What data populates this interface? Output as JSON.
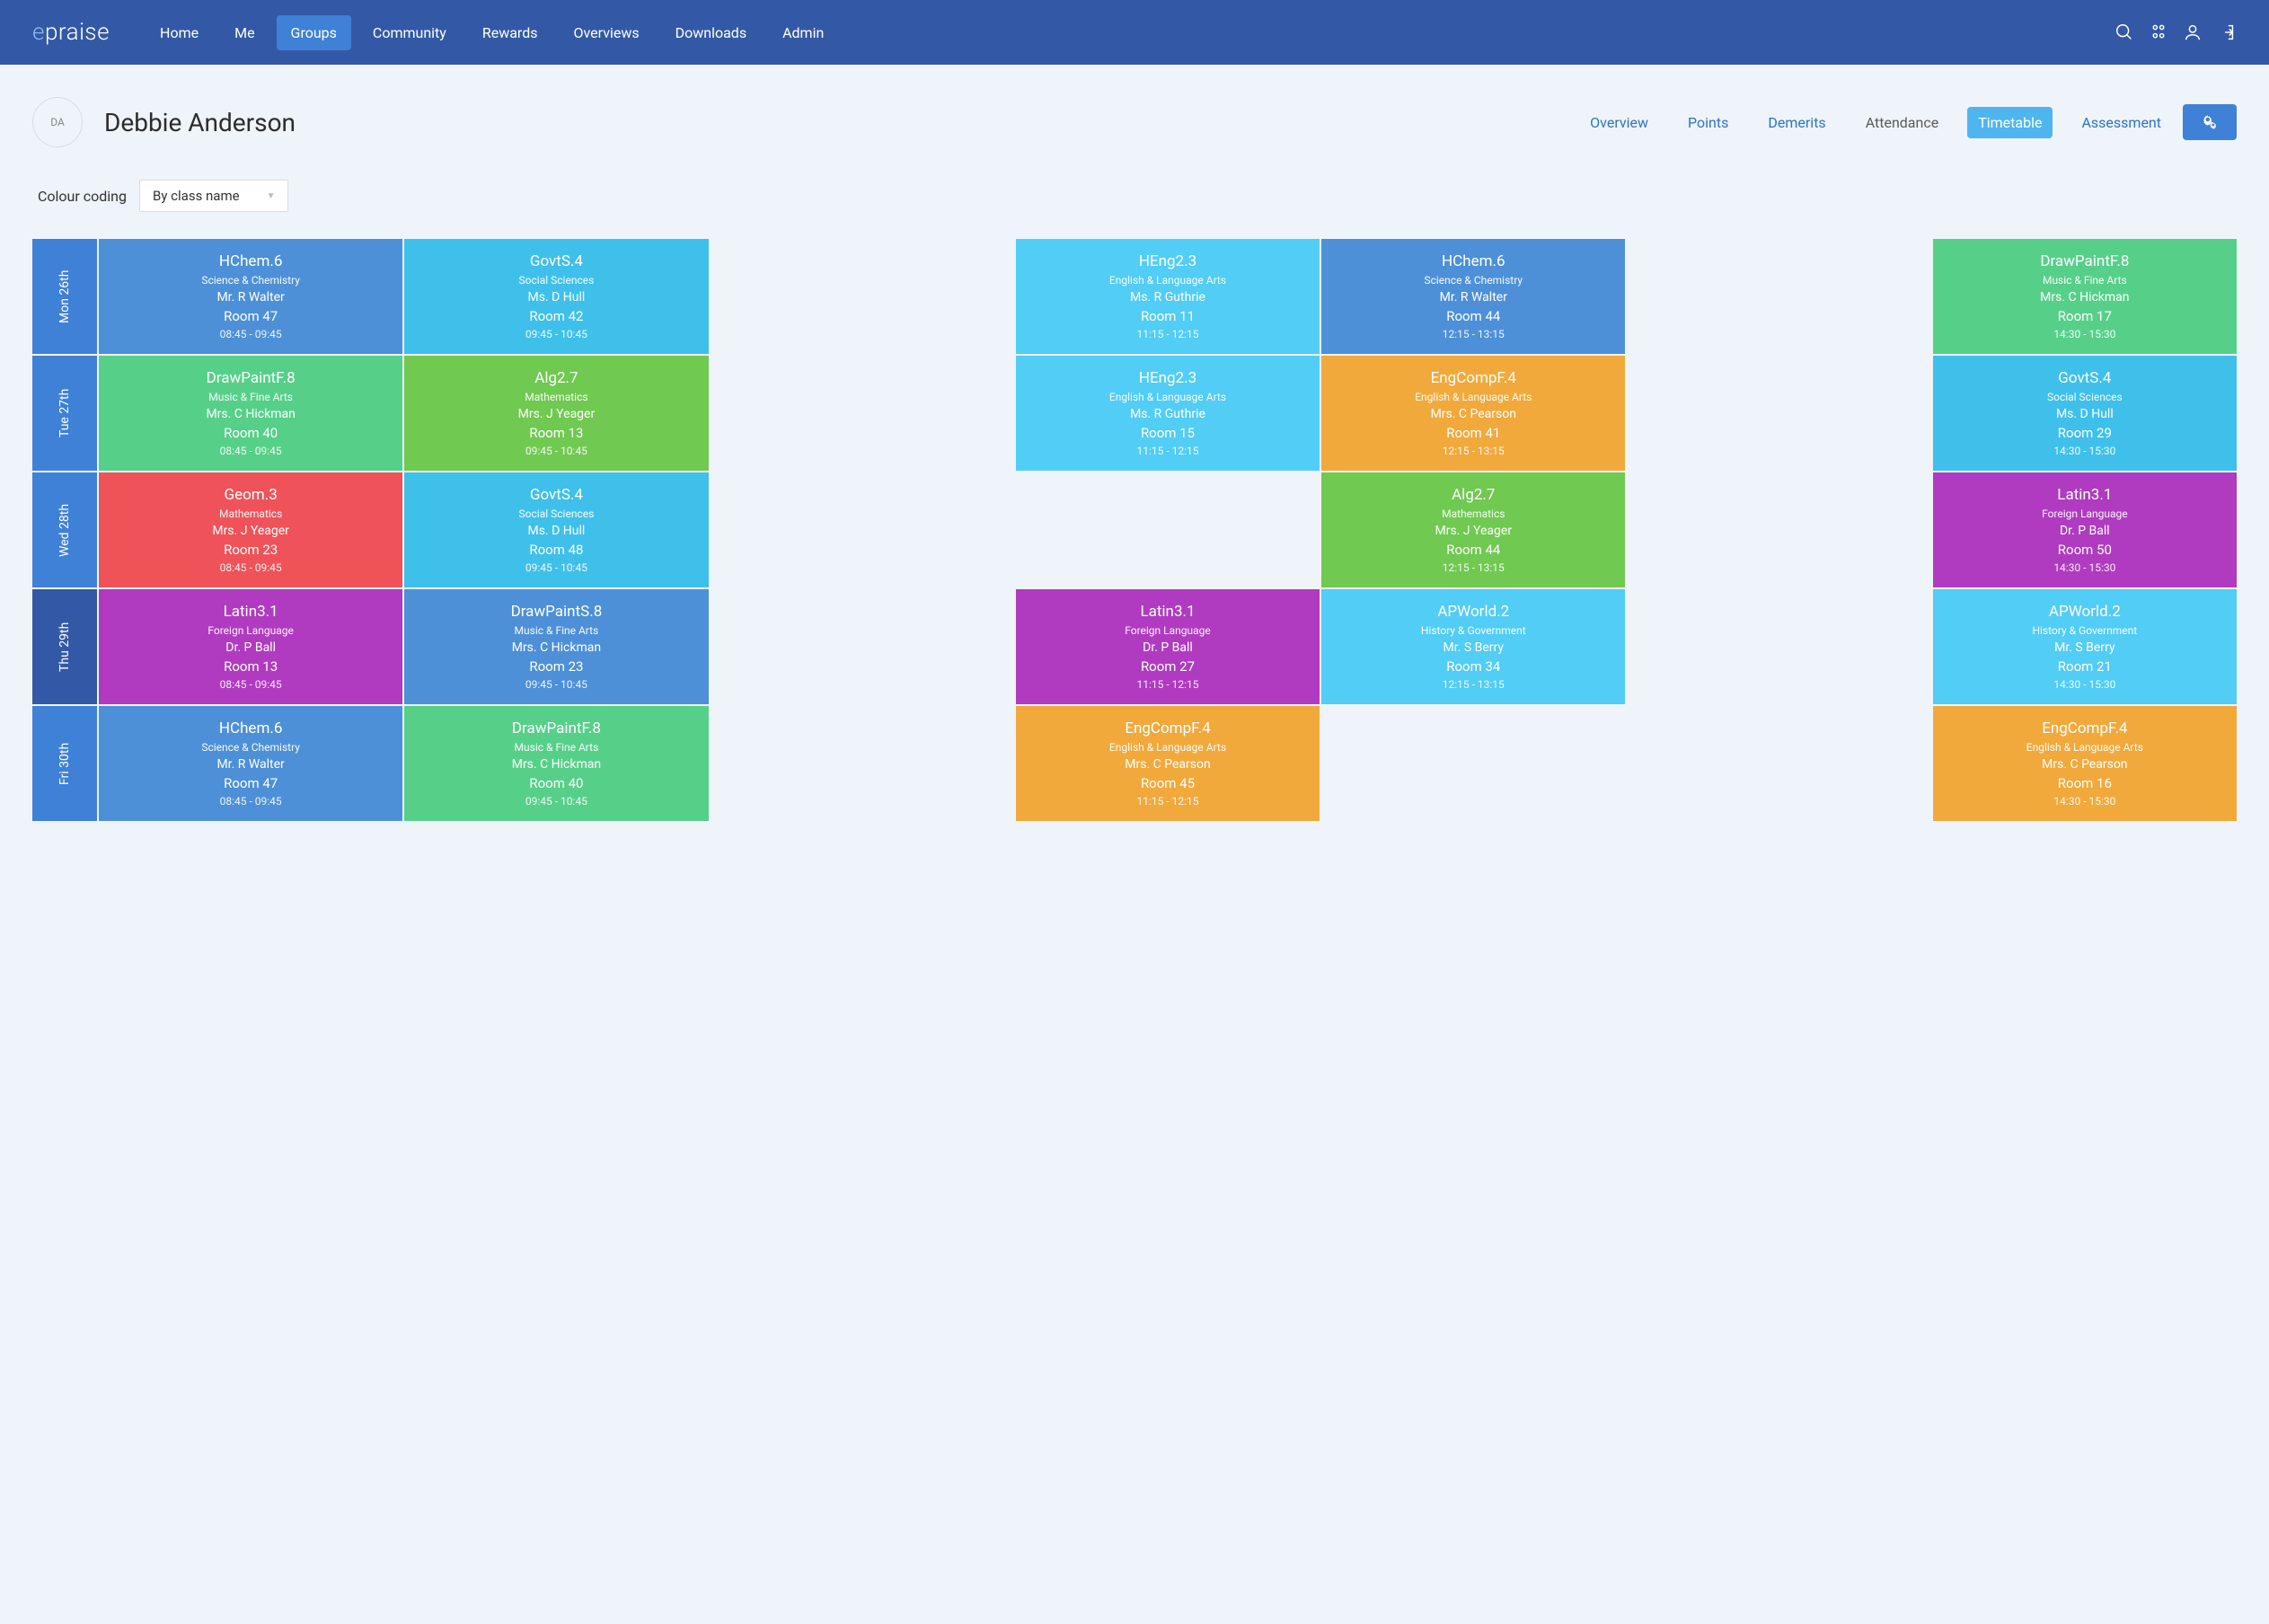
{
  "logo": {
    "e": "e",
    "rest": "praise"
  },
  "nav": [
    "Home",
    "Me",
    "Groups",
    "Community",
    "Rewards",
    "Overviews",
    "Downloads",
    "Admin"
  ],
  "nav_active": 2,
  "avatar_initials": "DA",
  "student_name": "Debbie Anderson",
  "tabs": [
    "Overview",
    "Points",
    "Demerits",
    "Attendance",
    "Timetable",
    "Assessment"
  ],
  "tab_active": 4,
  "tab_muted": [
    3
  ],
  "colour_coding_label": "Colour coding",
  "dropdown_value": "By class name",
  "colors": {
    "blue": "#4d90d8",
    "lightblue": "#3fc0eb",
    "skyblue": "#52cdf5",
    "green": "#56d089",
    "green2": "#70c951",
    "orange": "#f2a93c",
    "red": "#ef5359",
    "purple": "#b03bc0"
  },
  "days": [
    {
      "label": "Mon 26th",
      "darker": false,
      "cells": [
        {
          "code": "HChem.6",
          "dept": "Science & Chemistry",
          "teacher": "Mr. R Walter",
          "room": "Room 47",
          "time": "08:45 - 09:45",
          "color": "blue"
        },
        {
          "code": "GovtS.4",
          "dept": "Social Sciences",
          "teacher": "Ms. D Hull",
          "room": "Room 42",
          "time": "09:45 - 10:45",
          "color": "lightblue"
        },
        null,
        {
          "code": "HEng2.3",
          "dept": "English & Language Arts",
          "teacher": "Ms. R Guthrie",
          "room": "Room 11",
          "time": "11:15 - 12:15",
          "color": "skyblue"
        },
        {
          "code": "HChem.6",
          "dept": "Science & Chemistry",
          "teacher": "Mr. R Walter",
          "room": "Room 44",
          "time": "12:15 - 13:15",
          "color": "blue"
        },
        null,
        {
          "code": "DrawPaintF.8",
          "dept": "Music & Fine Arts",
          "teacher": "Mrs. C Hickman",
          "room": "Room 17",
          "time": "14:30 - 15:30",
          "color": "green"
        }
      ]
    },
    {
      "label": "Tue 27th",
      "darker": false,
      "cells": [
        {
          "code": "DrawPaintF.8",
          "dept": "Music & Fine Arts",
          "teacher": "Mrs. C Hickman",
          "room": "Room 40",
          "time": "08:45 - 09:45",
          "color": "green"
        },
        {
          "code": "Alg2.7",
          "dept": "Mathematics",
          "teacher": "Mrs. J Yeager",
          "room": "Room 13",
          "time": "09:45 - 10:45",
          "color": "green2"
        },
        null,
        {
          "code": "HEng2.3",
          "dept": "English & Language Arts",
          "teacher": "Ms. R Guthrie",
          "room": "Room 15",
          "time": "11:15 - 12:15",
          "color": "skyblue"
        },
        {
          "code": "EngCompF.4",
          "dept": "English & Language Arts",
          "teacher": "Mrs. C Pearson",
          "room": "Room 41",
          "time": "12:15 - 13:15",
          "color": "orange"
        },
        null,
        {
          "code": "GovtS.4",
          "dept": "Social Sciences",
          "teacher": "Ms. D Hull",
          "room": "Room 29",
          "time": "14:30 - 15:30",
          "color": "lightblue"
        }
      ]
    },
    {
      "label": "Wed 28th",
      "darker": false,
      "cells": [
        {
          "code": "Geom.3",
          "dept": "Mathematics",
          "teacher": "Mrs. J Yeager",
          "room": "Room 23",
          "time": "08:45 - 09:45",
          "color": "red"
        },
        {
          "code": "GovtS.4",
          "dept": "Social Sciences",
          "teacher": "Ms. D Hull",
          "room": "Room 48",
          "time": "09:45 - 10:45",
          "color": "lightblue"
        },
        null,
        null,
        {
          "code": "Alg2.7",
          "dept": "Mathematics",
          "teacher": "Mrs. J Yeager",
          "room": "Room 44",
          "time": "12:15 - 13:15",
          "color": "green2"
        },
        null,
        {
          "code": "Latin3.1",
          "dept": "Foreign Language",
          "teacher": "Dr. P Ball",
          "room": "Room 50",
          "time": "14:30 - 15:30",
          "color": "purple"
        }
      ]
    },
    {
      "label": "Thu 29th",
      "darker": true,
      "cells": [
        {
          "code": "Latin3.1",
          "dept": "Foreign Language",
          "teacher": "Dr. P Ball",
          "room": "Room 13",
          "time": "08:45 - 09:45",
          "color": "purple"
        },
        {
          "code": "DrawPaintS.8",
          "dept": "Music & Fine Arts",
          "teacher": "Mrs. C Hickman",
          "room": "Room 23",
          "time": "09:45 - 10:45",
          "color": "blue"
        },
        null,
        {
          "code": "Latin3.1",
          "dept": "Foreign Language",
          "teacher": "Dr. P Ball",
          "room": "Room 27",
          "time": "11:15 - 12:15",
          "color": "purple"
        },
        {
          "code": "APWorld.2",
          "dept": "History & Government",
          "teacher": "Mr. S Berry",
          "room": "Room 34",
          "time": "12:15 - 13:15",
          "color": "skyblue"
        },
        null,
        {
          "code": "APWorld.2",
          "dept": "History & Government",
          "teacher": "Mr. S Berry",
          "room": "Room 21",
          "time": "14:30 - 15:30",
          "color": "skyblue"
        }
      ]
    },
    {
      "label": "Fri 30th",
      "darker": false,
      "cells": [
        {
          "code": "HChem.6",
          "dept": "Science & Chemistry",
          "teacher": "Mr. R Walter",
          "room": "Room 47",
          "time": "08:45 - 09:45",
          "color": "blue"
        },
        {
          "code": "DrawPaintF.8",
          "dept": "Music & Fine Arts",
          "teacher": "Mrs. C Hickman",
          "room": "Room 40",
          "time": "09:45 - 10:45",
          "color": "green"
        },
        null,
        {
          "code": "EngCompF.4",
          "dept": "English & Language Arts",
          "teacher": "Mrs. C Pearson",
          "room": "Room 45",
          "time": "11:15 - 12:15",
          "color": "orange"
        },
        null,
        null,
        {
          "code": "EngCompF.4",
          "dept": "English & Language Arts",
          "teacher": "Mrs. C Pearson",
          "room": "Room 16",
          "time": "14:30 - 15:30",
          "color": "orange"
        }
      ]
    }
  ]
}
